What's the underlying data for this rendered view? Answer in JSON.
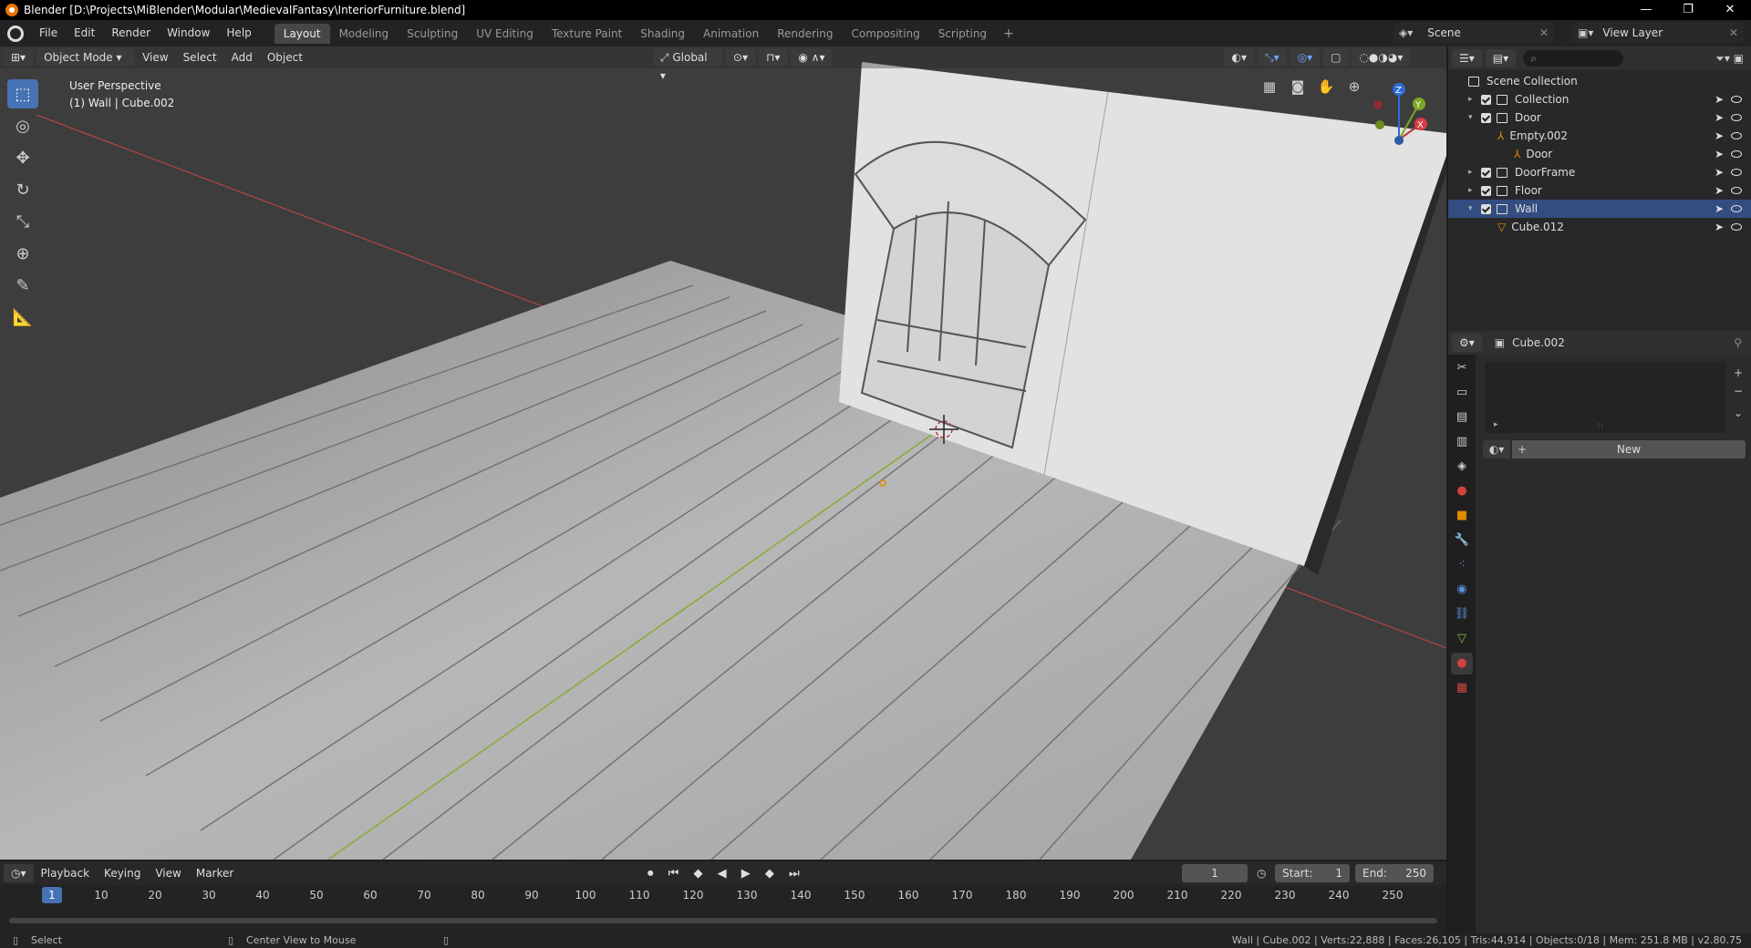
{
  "window": {
    "title": "Blender [D:\\Projects\\MiBlender\\Modular\\MedievalFantasy\\InteriorFurniture.blend]",
    "controls": [
      "—",
      "❐",
      "✕"
    ]
  },
  "menubar": {
    "menus": [
      "File",
      "Edit",
      "Render",
      "Window",
      "Help"
    ],
    "workspaces": [
      "Layout",
      "Modeling",
      "Sculpting",
      "UV Editing",
      "Texture Paint",
      "Shading",
      "Animation",
      "Rendering",
      "Compositing",
      "Scripting"
    ],
    "active_workspace": "Layout",
    "add_tab": "+",
    "scene": "Scene",
    "view_layer": "View Layer"
  },
  "viewport": {
    "mode": "Object Mode",
    "menus": [
      "View",
      "Select",
      "Add",
      "Object"
    ],
    "orientation": "Global",
    "info_line1": "User Perspective",
    "info_line2": "(1) Wall | Cube.002",
    "gizmo_axes": {
      "x": "X",
      "y": "Y",
      "z": "Z"
    },
    "colors": {
      "bg": "#3d3d3d",
      "x_axis": "#c0393b",
      "y_axis": "#7ea626",
      "accent": "#4772b3"
    }
  },
  "timeline": {
    "menus": [
      "Playback",
      "Keying",
      "View",
      "Marker"
    ],
    "current_frame": "1",
    "start_label": "Start:",
    "start": "1",
    "end_label": "End:",
    "end": "250",
    "ticks": [
      "10",
      "20",
      "30",
      "40",
      "50",
      "60",
      "70",
      "80",
      "90",
      "100",
      "110",
      "120",
      "130",
      "140",
      "150",
      "160",
      "170",
      "180",
      "190",
      "200",
      "210",
      "220",
      "230",
      "240",
      "250"
    ],
    "cursor_label": "1"
  },
  "outliner": {
    "root": "Scene Collection",
    "rows": [
      {
        "label": "Collection",
        "indent": 0
      },
      {
        "label": "Door",
        "indent": 0
      },
      {
        "label": "Empty.002",
        "indent": 1
      },
      {
        "label": "Door",
        "indent": 2
      },
      {
        "label": "DoorFrame",
        "indent": 0
      },
      {
        "label": "Floor",
        "indent": 0
      },
      {
        "label": "Wall",
        "indent": 0,
        "selected": true
      },
      {
        "label": "Cube.012",
        "indent": 1
      }
    ]
  },
  "properties": {
    "object": "Cube.002",
    "new_button": "New"
  },
  "statusbar": {
    "select": "Select",
    "center": "Center View to Mouse",
    "stats": "Wall | Cube.002 | Verts:22,888 | Faces:26,105 | Tris:44,914 | Objects:0/18 | Mem: 251.8 MB | v2.80.75"
  }
}
